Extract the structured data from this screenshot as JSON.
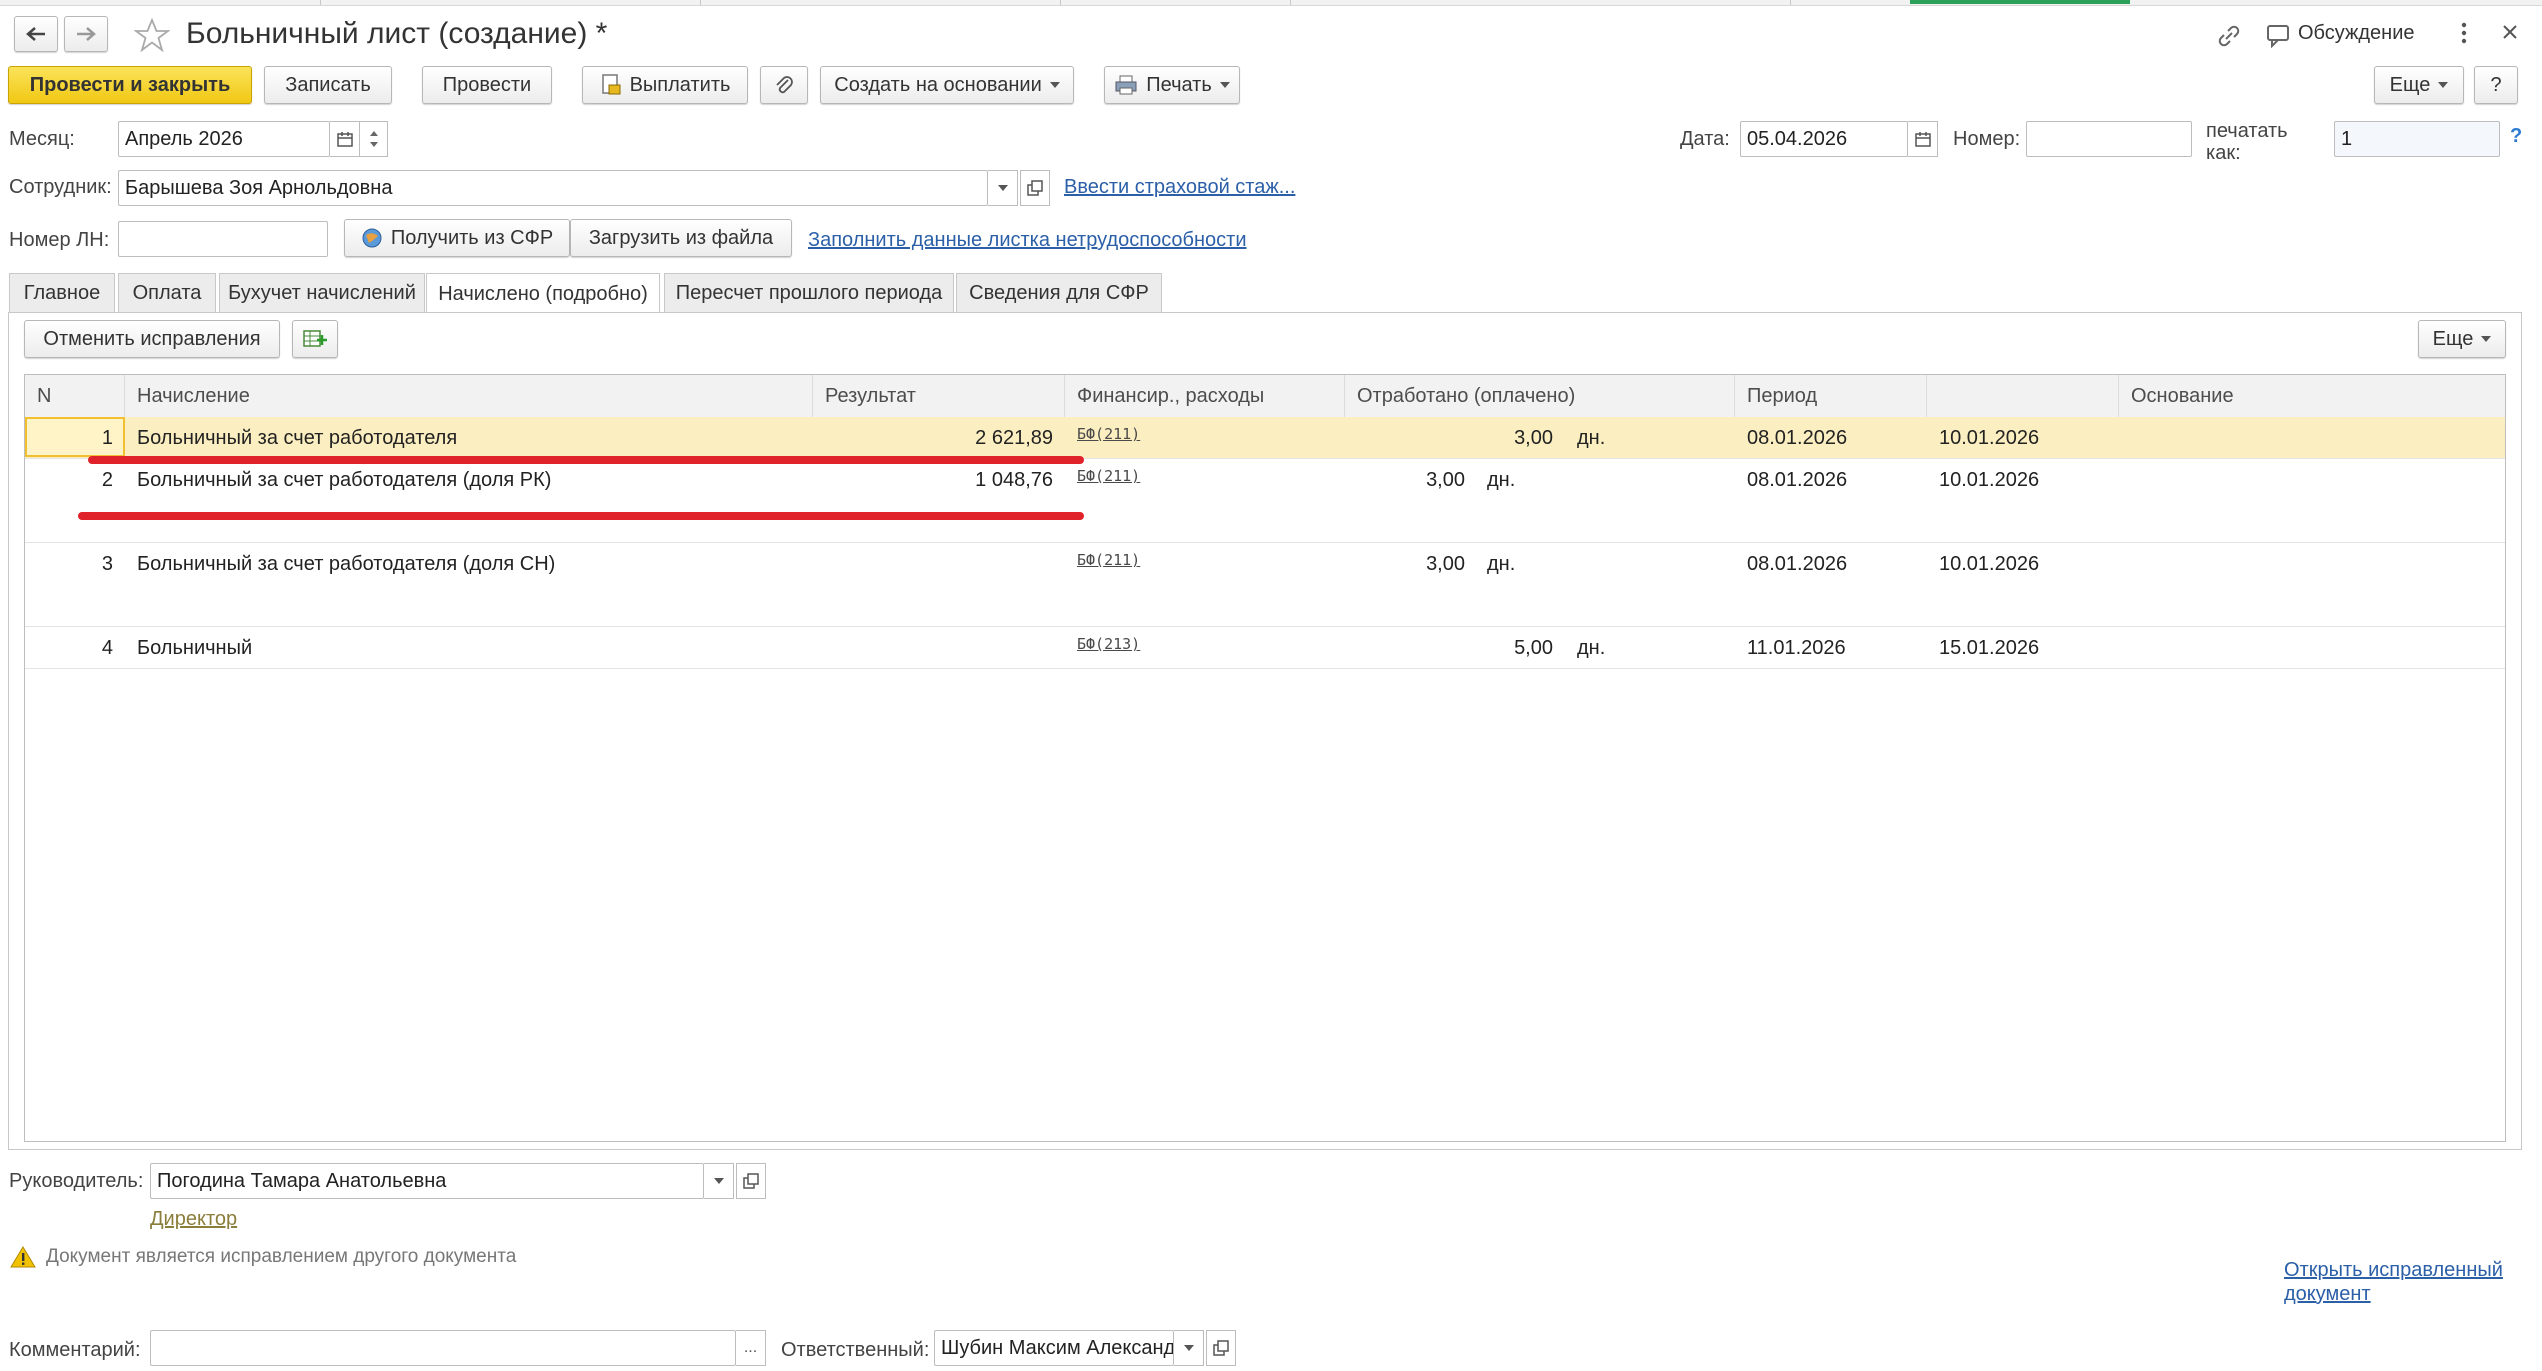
{
  "window": {
    "title": "Больничный лист (создание) *",
    "discussion_label": "Обсуждение",
    "accent_color": "#2da15a"
  },
  "toolbar": {
    "post_close": "Провести и закрыть",
    "save": "Записать",
    "post": "Провести",
    "pay": "Выплатить",
    "create_based": "Создать на основании",
    "print": "Печать",
    "more": "Еще",
    "help": "?"
  },
  "header": {
    "month_label": "Месяц:",
    "month_value": "Апрель 2026",
    "date_label": "Дата:",
    "date_value": "05.04.2026",
    "number_label": "Номер:",
    "number_value": "",
    "print_as_label_1": "печатать",
    "print_as_label_2": "как:",
    "print_as_value": "1",
    "help_mark": "?",
    "employee_label": "Сотрудник:",
    "employee_value": "Барышева Зоя Арнольдовна",
    "insurance_link": "Ввести страховой стаж...",
    "ln_label": "Номер ЛН:",
    "ln_value": "",
    "get_sfr": "Получить из СФР",
    "load_file": "Загрузить из файла",
    "fill_link": "Заполнить данные листка нетрудоспособности"
  },
  "tabs": [
    {
      "label": "Главное"
    },
    {
      "label": "Оплата"
    },
    {
      "label": "Бухучет начислений"
    },
    {
      "label": "Начислено (подробно)"
    },
    {
      "label": "Пересчет прошлого периода"
    },
    {
      "label": "Сведения для СФР"
    }
  ],
  "active_tab_index": 3,
  "table_toolbar": {
    "cancel_corrections": "Отменить исправления",
    "more": "Еще"
  },
  "table": {
    "columns": [
      "N",
      "Начисление",
      "Результат",
      "Финансир., расходы",
      "Отработано (оплачено)",
      "Период",
      "",
      "Основание"
    ],
    "rows": [
      {
        "n": "1",
        "accrual": "Больничный за счет работодателя",
        "result": "2 621,89",
        "finance": "БФ(211)",
        "worked": "3,00",
        "unit": "дн.",
        "from": "08.01.2026",
        "to": "10.01.2026",
        "basis": ""
      },
      {
        "n": "2",
        "accrual": "Больничный за счет работодателя (доля РК)",
        "result": "1 048,76",
        "finance": "БФ(211)",
        "worked": "3,00",
        "unit": "дн.",
        "from": "08.01.2026",
        "to": "10.01.2026",
        "basis": ""
      },
      {
        "n": "3",
        "accrual": "Больничный за счет работодателя (доля СН)",
        "result": "",
        "finance": "БФ(211)",
        "worked": "3,00",
        "unit": "дн.",
        "from": "08.01.2026",
        "to": "10.01.2026",
        "basis": ""
      },
      {
        "n": "4",
        "accrual": "Больничный",
        "result": "",
        "finance": "БФ(213)",
        "worked": "5,00",
        "unit": "дн.",
        "from": "11.01.2026",
        "to": "15.01.2026",
        "basis": ""
      }
    ],
    "selected_row": 0
  },
  "footer": {
    "manager_label": "Руководитель:",
    "manager_value": "Погодина Тамара Анатольевна",
    "manager_position": "Директор",
    "warning_text": "Документ является исправлением другого документа",
    "open_corrected_1": "Открыть исправленный",
    "open_corrected_2": "документ",
    "comment_label": "Комментарий:",
    "comment_value": "",
    "comment_btn": "...",
    "responsible_label": "Ответственный:",
    "responsible_value": "Шубин Максим Александрович"
  },
  "colors": {
    "primary_button": "#f0c814",
    "selected_row": "#fbeec0",
    "link": "#2b5fa8",
    "annotation_line": "#e0222a"
  }
}
